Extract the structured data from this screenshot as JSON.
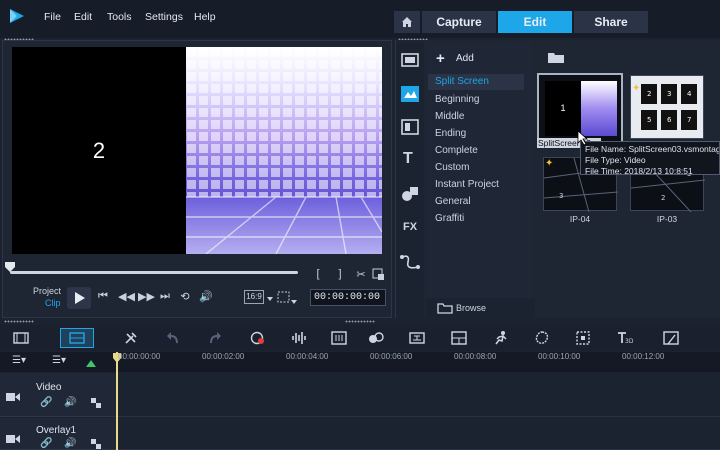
{
  "menu": {
    "items": [
      "File",
      "Edit",
      "Tools",
      "Settings",
      "Help"
    ]
  },
  "tabs": [
    "Capture",
    "Edit",
    "Share"
  ],
  "preview": {
    "overlay_number": "2",
    "project_label": "Project",
    "clip_label": "Clip",
    "aspect_ratio": "16:9",
    "timecode": "00:00:00:00",
    "scrub_position": 0
  },
  "library": {
    "add_label": "Add",
    "categories": [
      "Split Screen",
      "Beginning",
      "Middle",
      "Ending",
      "Complete",
      "Custom",
      "Instant Project",
      "General",
      "Graffiti"
    ],
    "selected_category": "Split Screen",
    "browse_label": "Browse",
    "thumbnails": [
      {
        "label": "SplitScreen03"
      },
      {
        "label": ""
      },
      {
        "label": "IP-04"
      },
      {
        "label": "IP-03"
      }
    ],
    "tooltip": {
      "file_name": "File Name: SplitScreen03.vsmontage",
      "file_type": "File Type: Video",
      "file_time": "File Time: 2018/2/13 10:8:51"
    }
  },
  "timeline": {
    "ticks": [
      "00:00:00:00",
      "00:00:02:00",
      "00:00:04:00",
      "00:00:06:00",
      "00:00:08:00",
      "00:00:10:00",
      "00:00:12:00"
    ],
    "tracks": [
      {
        "name": "Video"
      },
      {
        "name": "Overlay1"
      }
    ]
  },
  "colors": {
    "accent": "#1da6e8",
    "background": "#1b2230",
    "menubar": "#161c28"
  }
}
